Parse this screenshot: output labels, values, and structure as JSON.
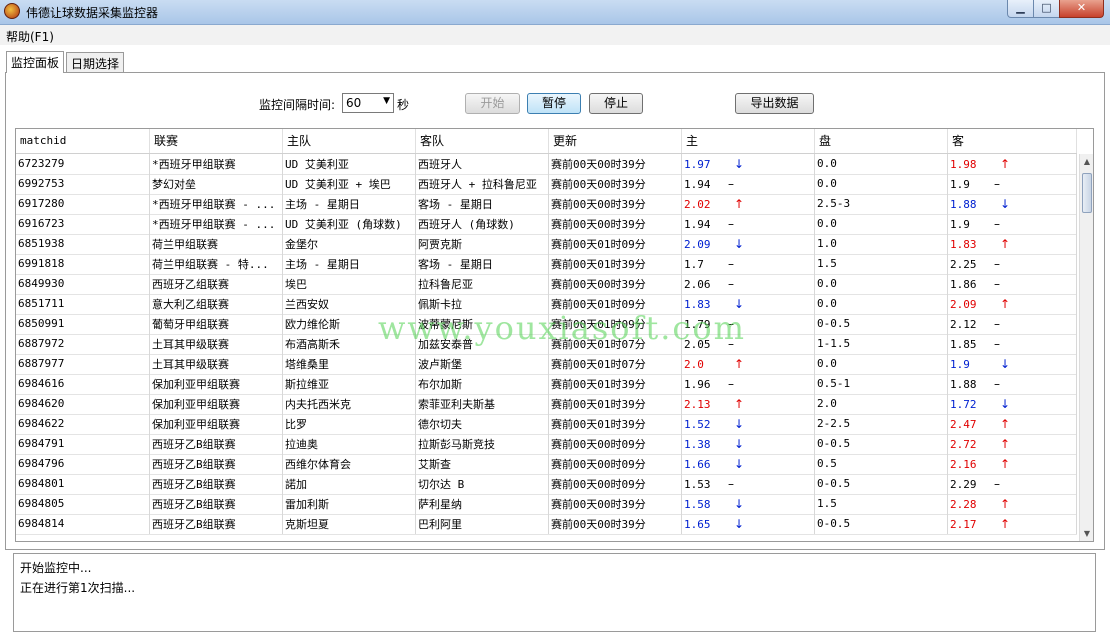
{
  "window": {
    "title": "伟德让球数据采集监控器"
  },
  "menu": {
    "help": "帮助(F1)"
  },
  "tabs": [
    {
      "label": "监控面板"
    },
    {
      "label": "日期选择"
    }
  ],
  "controls": {
    "interval_label": "监控间隔时间:",
    "interval_value": "60",
    "interval_unit": "秒",
    "start_label": "开始",
    "pause_label": "暂停",
    "stop_label": "停止",
    "export_label": "导出数据"
  },
  "table": {
    "columns": [
      "matchid",
      "联赛",
      "主队",
      "客队",
      "更新",
      "主",
      "盘",
      "客"
    ],
    "rows": [
      {
        "id": "6723279",
        "league": "*西班牙甲组联赛",
        "home": "UD 艾美利亚",
        "away": "西班牙人",
        "update": "赛前00天00时39分",
        "h": "1.97",
        "ht": "down",
        "line": "0.0",
        "a": "1.98",
        "at": "up"
      },
      {
        "id": "6992753",
        "league": "梦幻对垒",
        "home": "UD 艾美利亚 + 埃巴",
        "away": "西班牙人 + 拉科鲁尼亚",
        "update": "赛前00天00时39分",
        "h": "1.94",
        "ht": "none",
        "line": "0.0",
        "a": "1.9",
        "at": "none"
      },
      {
        "id": "6917280",
        "league": "*西班牙甲组联赛 - ...",
        "home": "主场 - 星期日",
        "away": "客场 - 星期日",
        "update": "赛前00天00时39分",
        "h": "2.02",
        "ht": "up",
        "line": "2.5-3",
        "a": "1.88",
        "at": "down"
      },
      {
        "id": "6916723",
        "league": "*西班牙甲组联赛 - ...",
        "home": "UD 艾美利亚 (角球数)",
        "away": "西班牙人 (角球数)",
        "update": "赛前00天00时39分",
        "h": "1.94",
        "ht": "none",
        "line": "0.0",
        "a": "1.9",
        "at": "none"
      },
      {
        "id": "6851938",
        "league": "荷兰甲组联赛",
        "home": "金堡尔",
        "away": "阿贾克斯",
        "update": "赛前00天01时09分",
        "h": "2.09",
        "ht": "down",
        "line": "1.0",
        "a": "1.83",
        "at": "up"
      },
      {
        "id": "6991818",
        "league": "荷兰甲组联赛 - 特...",
        "home": "主场 - 星期日",
        "away": "客场 - 星期日",
        "update": "赛前00天01时39分",
        "h": "1.7",
        "ht": "none",
        "line": "1.5",
        "a": "2.25",
        "at": "none"
      },
      {
        "id": "6849930",
        "league": "西班牙乙组联赛",
        "home": "埃巴",
        "away": "拉科鲁尼亚",
        "update": "赛前00天00时39分",
        "h": "2.06",
        "ht": "none",
        "line": "0.0",
        "a": "1.86",
        "at": "none"
      },
      {
        "id": "6851711",
        "league": "意大利乙组联赛",
        "home": "兰西安奴",
        "away": "佩斯卡拉",
        "update": "赛前00天01时09分",
        "h": "1.83",
        "ht": "down",
        "line": "0.0",
        "a": "2.09",
        "at": "up"
      },
      {
        "id": "6850991",
        "league": "葡萄牙甲组联赛",
        "home": "欧力维伦斯",
        "away": "波蒂蒙尼斯",
        "update": "赛前00天01时09分",
        "h": "1.79",
        "ht": "none",
        "line": "0-0.5",
        "a": "2.12",
        "at": "none"
      },
      {
        "id": "6887972",
        "league": "土耳其甲级联赛",
        "home": "布酒高斯禾",
        "away": "加兹安泰普",
        "update": "赛前00天01时07分",
        "h": "2.05",
        "ht": "none",
        "line": "1-1.5",
        "a": "1.85",
        "at": "none"
      },
      {
        "id": "6887977",
        "league": "土耳其甲级联赛",
        "home": "塔维桑里",
        "away": "波卢斯堡",
        "update": "赛前00天01时07分",
        "h": "2.0",
        "ht": "up",
        "line": "0.0",
        "a": "1.9",
        "at": "down"
      },
      {
        "id": "6984616",
        "league": "保加利亚甲组联赛",
        "home": "斯拉维亚",
        "away": "布尔加斯",
        "update": "赛前00天01时39分",
        "h": "1.96",
        "ht": "none",
        "line": "0.5-1",
        "a": "1.88",
        "at": "none"
      },
      {
        "id": "6984620",
        "league": "保加利亚甲组联赛",
        "home": "内夫托西米克",
        "away": "索菲亚利夫斯基",
        "update": "赛前00天01时39分",
        "h": "2.13",
        "ht": "up",
        "line": "2.0",
        "a": "1.72",
        "at": "down"
      },
      {
        "id": "6984622",
        "league": "保加利亚甲组联赛",
        "home": "比罗",
        "away": "德尔切夫",
        "update": "赛前00天01时39分",
        "h": "1.52",
        "ht": "down",
        "line": "2-2.5",
        "a": "2.47",
        "at": "up"
      },
      {
        "id": "6984791",
        "league": "西班牙乙B组联赛",
        "home": "拉迪奥",
        "away": "拉斯彭马斯竞技",
        "update": "赛前00天00时09分",
        "h": "1.38",
        "ht": "down",
        "line": "0-0.5",
        "a": "2.72",
        "at": "up"
      },
      {
        "id": "6984796",
        "league": "西班牙乙B组联赛",
        "home": "西维尔体育会",
        "away": "艾斯查",
        "update": "赛前00天00时09分",
        "h": "1.66",
        "ht": "down",
        "line": "0.5",
        "a": "2.16",
        "at": "up"
      },
      {
        "id": "6984801",
        "league": "西班牙乙B组联赛",
        "home": "諾加",
        "away": "切尔达 B",
        "update": "赛前00天00时09分",
        "h": "1.53",
        "ht": "none",
        "line": "0-0.5",
        "a": "2.29",
        "at": "none"
      },
      {
        "id": "6984805",
        "league": "西班牙乙B组联赛",
        "home": "雷加利斯",
        "away": "萨利星纳",
        "update": "赛前00天00时39分",
        "h": "1.58",
        "ht": "down",
        "line": "1.5",
        "a": "2.28",
        "at": "up"
      },
      {
        "id": "6984814",
        "league": "西班牙乙B组联赛",
        "home": "克斯坦夏",
        "away": "巴利阿里",
        "update": "赛前00天00时39分",
        "h": "1.65",
        "ht": "down",
        "line": "0-0.5",
        "a": "2.17",
        "at": "up"
      }
    ]
  },
  "trend_glyphs": {
    "up": "↑",
    "down": "↓",
    "none": "–"
  },
  "colors": {
    "up": "#e00000",
    "down": "#0020d0"
  },
  "log": {
    "lines": [
      "开始监控中...",
      "正在进行第1次扫描..."
    ]
  },
  "watermark": "www.youxiasoft.com"
}
